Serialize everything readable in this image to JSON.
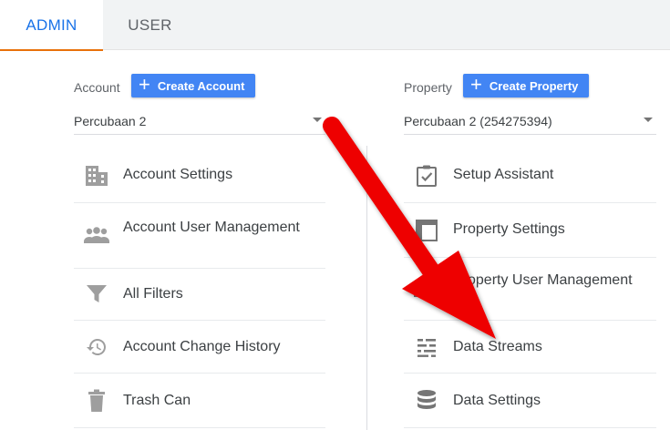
{
  "tabs": [
    {
      "label": "ADMIN",
      "active": true
    },
    {
      "label": "USER",
      "active": false
    }
  ],
  "account": {
    "label": "Account",
    "create_label": "Create Account",
    "selected": "Percubaan 2",
    "items": [
      {
        "label": "Account Settings",
        "icon": "building-icon"
      },
      {
        "label": "Account User Management",
        "icon": "people-icon"
      },
      {
        "label": "All Filters",
        "icon": "filter-icon"
      },
      {
        "label": "Account Change History",
        "icon": "history-icon"
      },
      {
        "label": "Trash Can",
        "icon": "trash-icon"
      }
    ]
  },
  "property": {
    "label": "Property",
    "create_label": "Create Property",
    "selected": "Percubaan 2 (254275394)",
    "items": [
      {
        "label": "Setup Assistant",
        "icon": "checklist-icon"
      },
      {
        "label": "Property Settings",
        "icon": "layout-icon"
      },
      {
        "label": "Property User Management",
        "icon": "people-icon"
      },
      {
        "label": "Data Streams",
        "icon": "streams-icon"
      },
      {
        "label": "Data Settings",
        "icon": "database-icon"
      }
    ]
  },
  "colors": {
    "accent": "#1a73e8",
    "button": "#4285f4",
    "tab_underline": "#e8710a",
    "icon": "#757575",
    "arrow": "#ee0000"
  }
}
